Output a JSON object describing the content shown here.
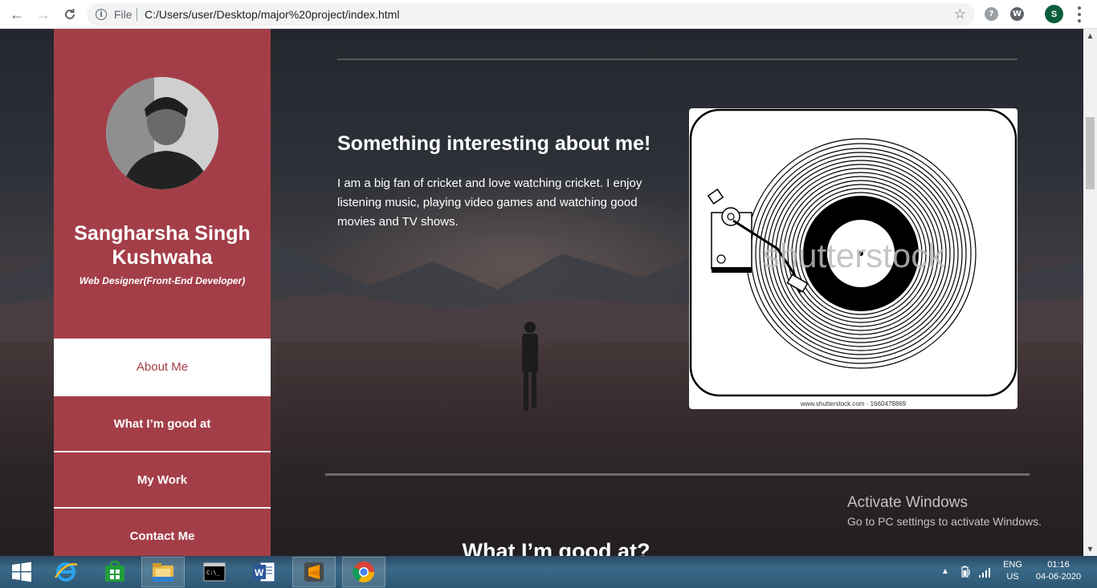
{
  "browser": {
    "file_label": "File",
    "url": "C:/Users/user/Desktop/major%20project/index.html",
    "profile_initial": "S"
  },
  "sidebar": {
    "name": "Sangharsha Singh Kushwaha",
    "role": "Web Designer(Front-End Developer)",
    "nav": [
      {
        "label": "About Me",
        "active": true
      },
      {
        "label": "What I’m good at",
        "active": false
      },
      {
        "label": "My Work",
        "active": false
      },
      {
        "label": "Contact Me",
        "active": false
      }
    ]
  },
  "main": {
    "section_title": "Something interesting about me!",
    "section_text": "I am a big fan of cricket and love watching cricket. I enjoy listening music, playing video games and watching good movies and TV shows.",
    "image_watermark": "shutterstock",
    "image_caption": "www.shutterstock.com · 1660478869",
    "next_section_title": "What I’m good at?"
  },
  "windows_activation": {
    "line1": "Activate Windows",
    "line2": "Go to PC settings to activate Windows."
  },
  "taskbar": {
    "apps": [
      "start-icon",
      "internet-explorer-icon",
      "store-icon",
      "file-explorer-icon",
      "command-prompt-icon",
      "word-icon",
      "sublime-text-icon",
      "chrome-icon"
    ],
    "lang_top": "ENG",
    "lang_bottom": "US",
    "time": "01:16",
    "date": "04-06-2020"
  },
  "colors": {
    "sidebar": "#a33e48",
    "accent_text": "#a33e48"
  }
}
